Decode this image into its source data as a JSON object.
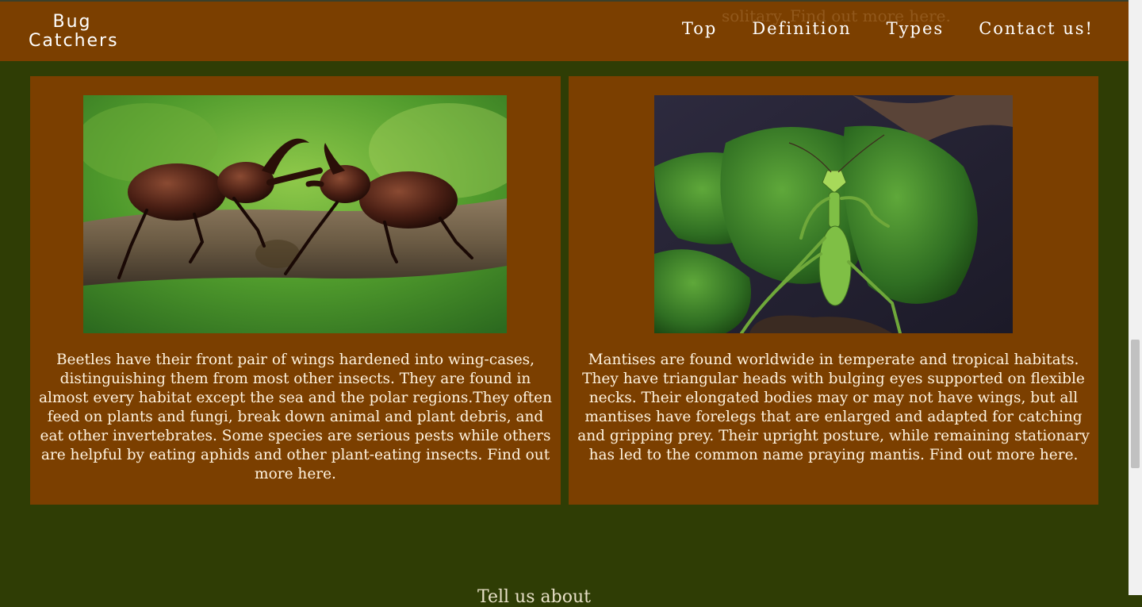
{
  "navbar": {
    "logo_line1": "Bug",
    "logo_line2": "Catchers",
    "links": [
      "Top",
      "Definition",
      "Types",
      "Contact us!"
    ]
  },
  "background_scroll_text": "solitary. Find out more here.",
  "cards": [
    {
      "image_alt": "Two rhinoceros beetles facing each other on a branch",
      "text": "Beetles have their front pair of wings hardened into wing-cases, distinguishing them from most other insects. They are found in almost every habitat except the sea and the polar regions.They often feed on plants and fungi, break down animal and plant debris, and eat other invertebrates. Some species are serious pests while others are helpful by eating aphids and other plant-eating insects. Find out more here."
    },
    {
      "image_alt": "Green praying mantis among leaves",
      "text": "Mantises are found worldwide in temperate and tropical habitats. They have triangular heads with bulging eyes supported on flexible necks. Their elongated bodies may or may not have wings, but all mantises have forelegs that are enlarged and adapted for catching and gripping prey. Their upright posture, while remaining stationary has led to the common name praying mantis. Find out more here."
    }
  ],
  "footer_teaser": "Tell us     about                                                        ",
  "colors": {
    "page_background": "#2f3d05",
    "card_background": "#7b3f00",
    "navbar_background": "#7b3f00",
    "text": "#fff3df"
  }
}
